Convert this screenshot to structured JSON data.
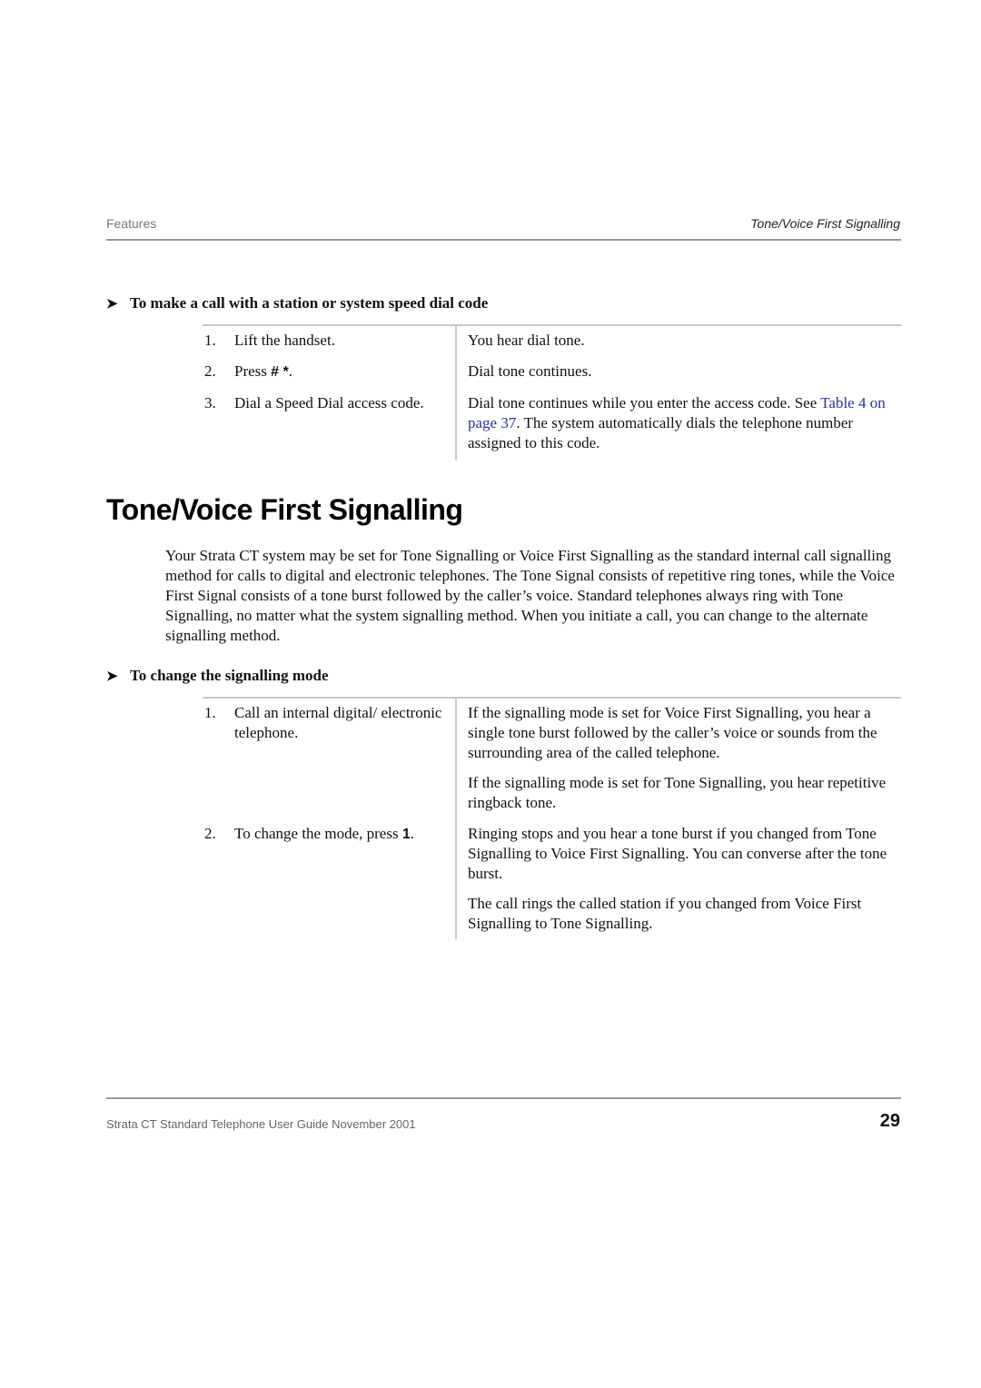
{
  "header": {
    "chapter": "Features",
    "section": "Tone/Voice First Signalling"
  },
  "procedure1": {
    "arrow_icon": "right-arrowhead",
    "title": "To make a call with a station or system speed dial code",
    "steps": [
      {
        "num": "1.",
        "action": "Lift the handset.",
        "result": "You hear dial tone."
      },
      {
        "num": "2.",
        "action_prefix": "Press ",
        "action_key": "# *",
        "action_suffix": ".",
        "result": "Dial tone continues."
      },
      {
        "num": "3.",
        "action": "Dial a Speed Dial access code.",
        "result_prefix": "Dial tone continues while you enter the access code. See ",
        "result_link": "Table 4 on page 37",
        "result_suffix": ". The system automatically dials the telephone number assigned to this code."
      }
    ]
  },
  "section": {
    "title": "Tone/Voice First Signalling",
    "intro": "Your Strata CT system may be set for Tone Signalling or Voice First Signalling as the standard internal call signalling method for calls to digital and electronic telephones. The Tone Signal consists of repetitive ring tones, while the Voice First Signal consists of a tone burst followed by the caller’s voice. Standard telephones always ring with Tone Signalling, no matter what the system signalling method. When you initiate a call, you can change to the alternate signalling method."
  },
  "procedure2": {
    "arrow_icon": "right-arrowhead",
    "title": "To change the signalling mode",
    "steps": [
      {
        "num": "1.",
        "action": "Call an internal digital/ electronic telephone.",
        "results": [
          "If the signalling mode is set for Voice First Signalling, you hear a single tone burst followed by the caller’s voice or sounds from the surrounding area of the called telephone.",
          "If the signalling mode is set for Tone Signalling, you hear repetitive ringback tone."
        ]
      },
      {
        "num": "2.",
        "action_prefix": "To change the mode, press ",
        "action_key": "1",
        "action_suffix": ".",
        "results": [
          "Ringing stops and you hear a tone burst if you changed from Tone Signalling to Voice First Signalling. You can converse after the tone burst.",
          "The call rings the called station if you changed from Voice First Signalling to Tone Signalling."
        ]
      }
    ]
  },
  "footer": {
    "guide": "Strata CT Standard Telephone User Guide  November 2001",
    "page_number": "29"
  },
  "colors": {
    "link": "#2030d0",
    "rule": "#999999",
    "table_rule": "#c8c8c8"
  }
}
